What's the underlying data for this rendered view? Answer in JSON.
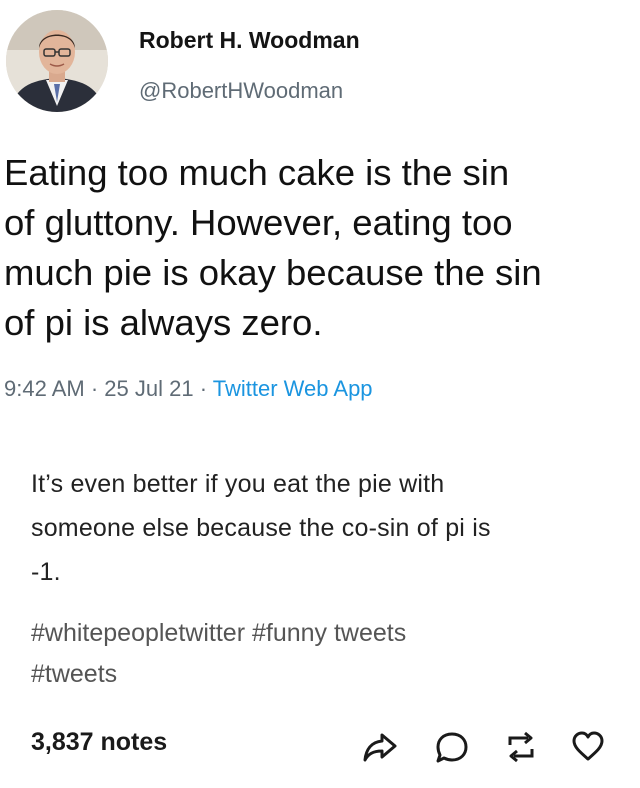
{
  "tweet": {
    "author_name": "Robert H. Woodman",
    "author_handle": "@RobertHWoodman",
    "text_lines": [
      "Eating too much cake is the sin",
      "of gluttony. However, eating too",
      "much pie is okay because the sin",
      "of pi is always zero."
    ],
    "time": "9:42 AM",
    "separator": "·",
    "date": "25 Jul 21",
    "source": "Twitter Web App",
    "source_color": "#1b95e0",
    "avatar_icon": "person-portrait-icon"
  },
  "post": {
    "body_lines": [
      "It’s even better if you eat the pie with",
      "someone else because the co-sin of pi is",
      "-1."
    ],
    "tags": [
      "#whitepeopletwitter",
      "#funny tweets",
      "#tweets"
    ],
    "notes_count": "3,837 notes"
  },
  "actions": {
    "share_icon": "share-icon",
    "reply_icon": "reply-icon",
    "reblog_icon": "reblog-icon",
    "like_icon": "heart-icon"
  }
}
